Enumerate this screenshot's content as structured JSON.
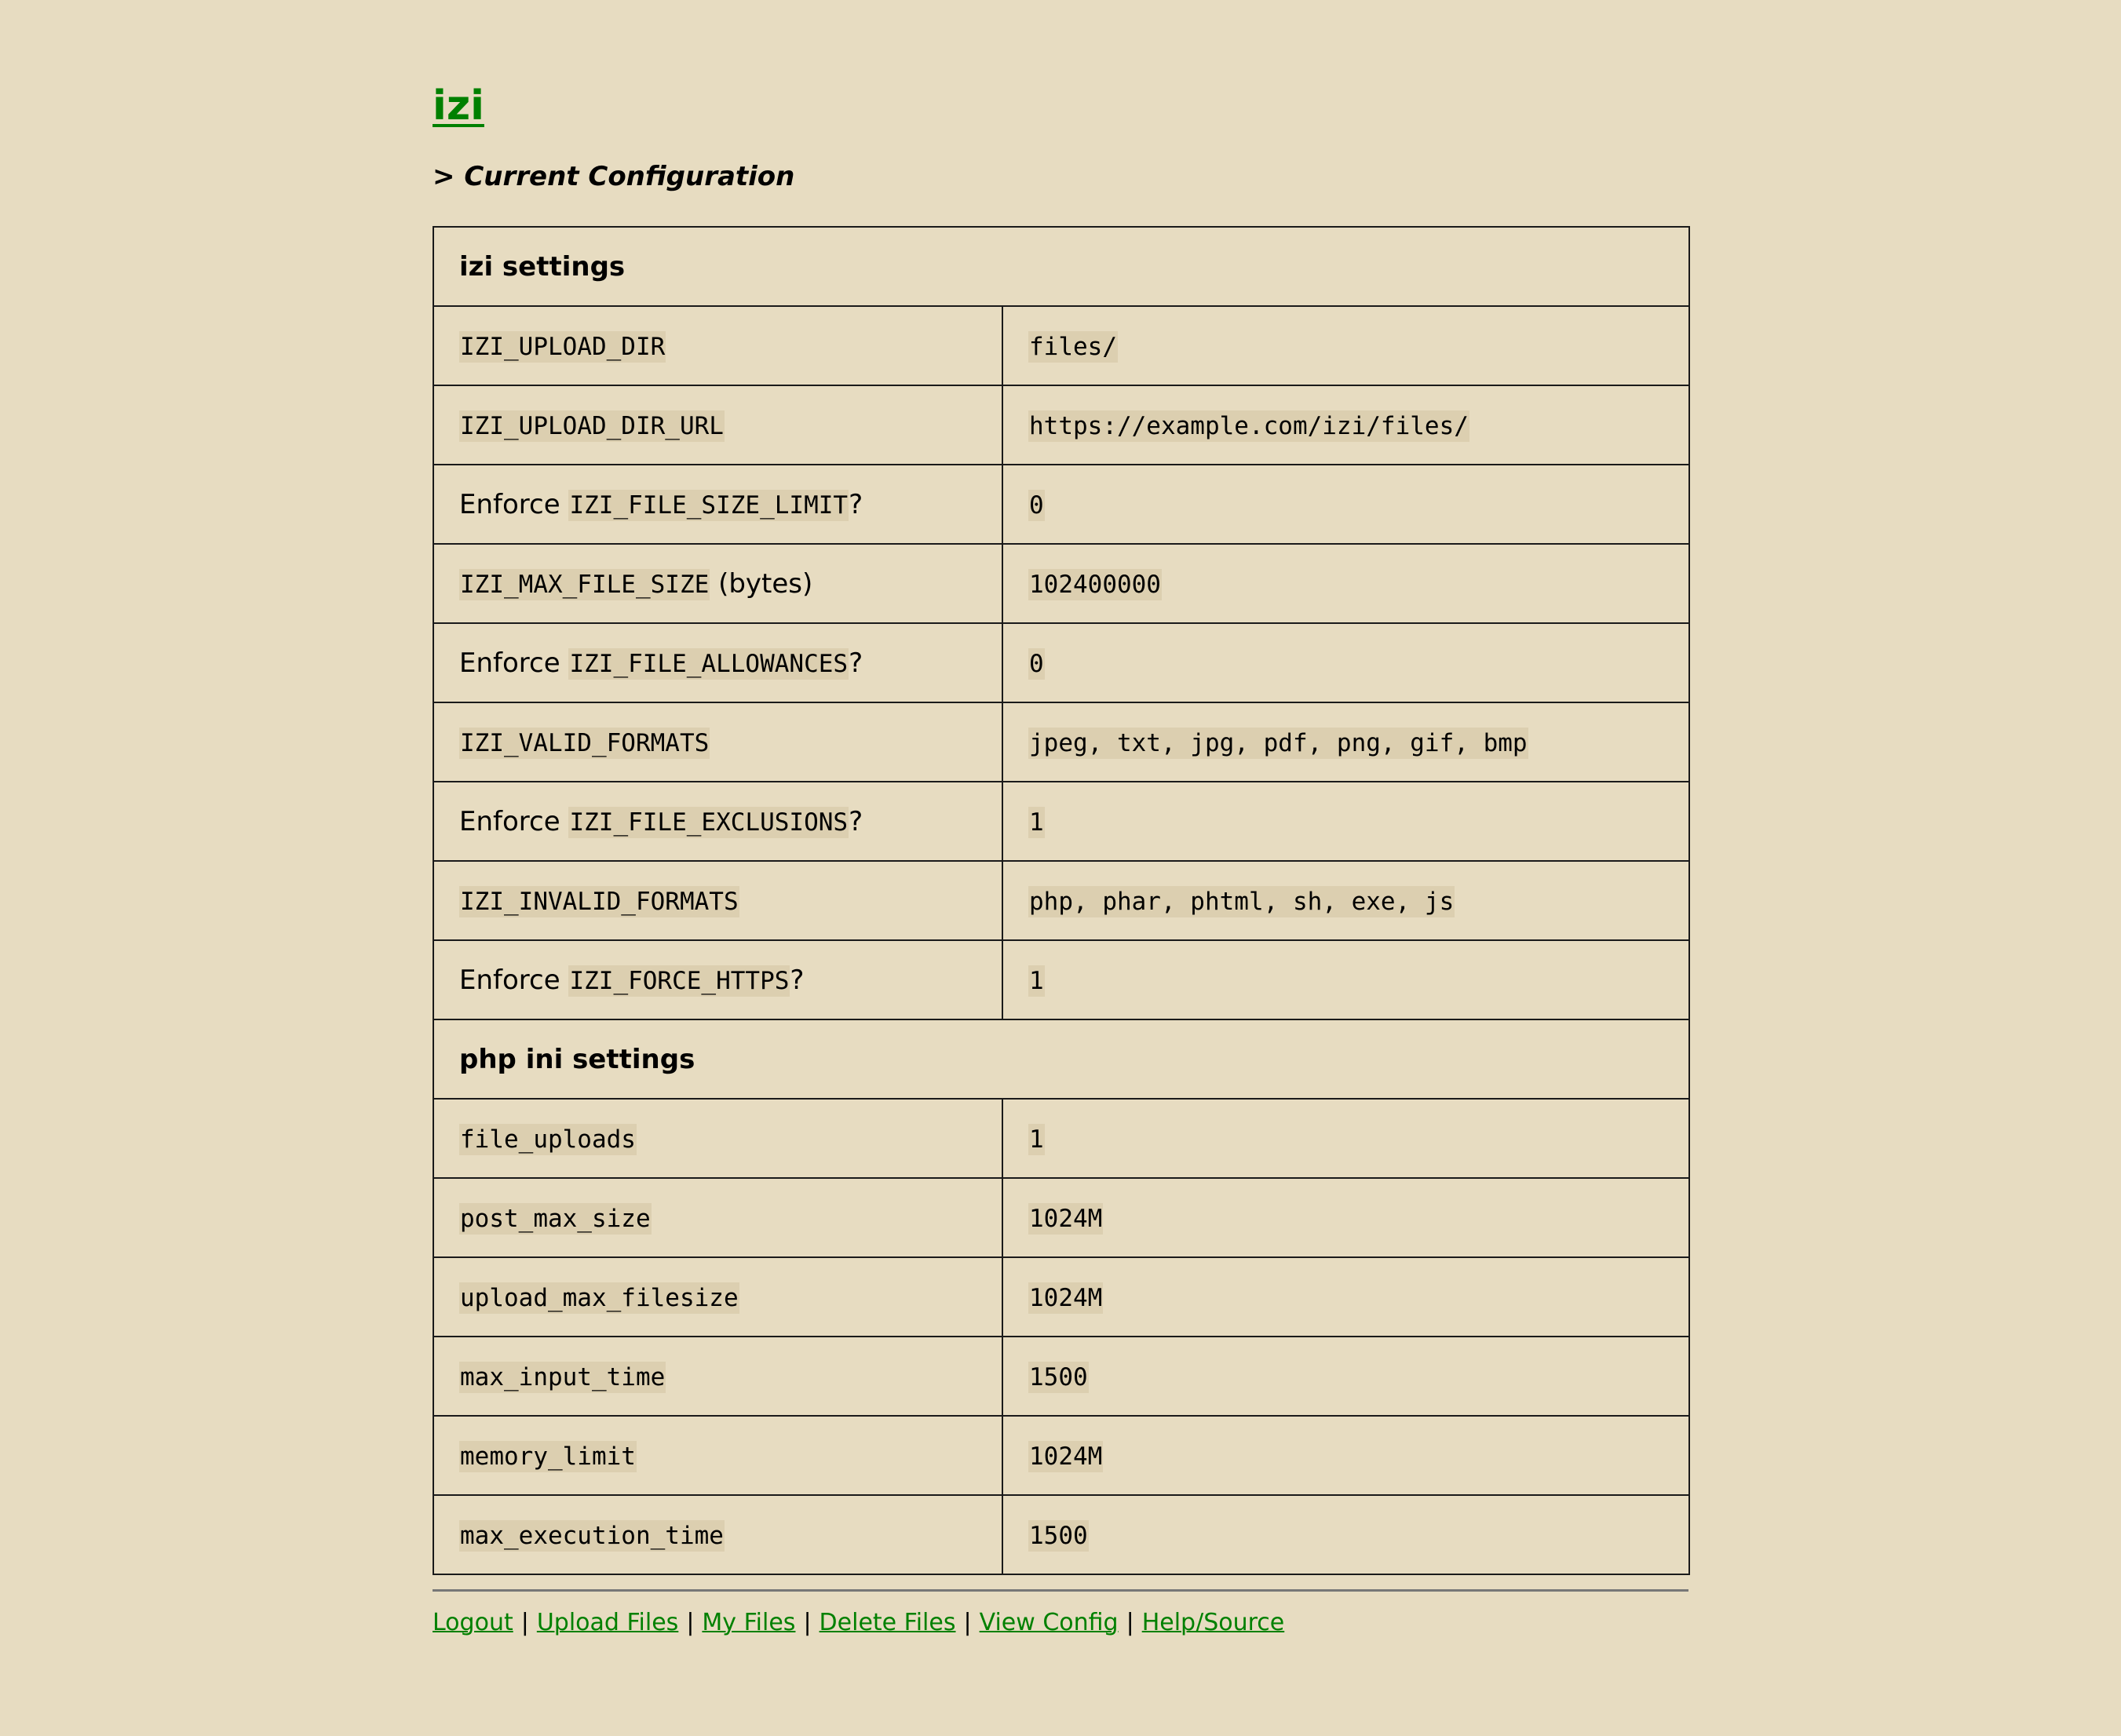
{
  "site": {
    "title": "izi",
    "subtitle": "> Current Configuration"
  },
  "izi_section": {
    "heading": "izi settings",
    "rows": [
      {
        "prefix": "",
        "code": "IZI_UPLOAD_DIR",
        "suffix": "",
        "value": "files/"
      },
      {
        "prefix": "",
        "code": "IZI_UPLOAD_DIR_URL",
        "suffix": "",
        "value": "https://example.com/izi/files/"
      },
      {
        "prefix": "Enforce ",
        "code": "IZI_FILE_SIZE_LIMIT",
        "suffix": "?",
        "value": "0"
      },
      {
        "prefix": "",
        "code": "IZI_MAX_FILE_SIZE",
        "suffix": " (bytes)",
        "value": "102400000"
      },
      {
        "prefix": "Enforce ",
        "code": "IZI_FILE_ALLOWANCES",
        "suffix": "?",
        "value": "0"
      },
      {
        "prefix": "",
        "code": "IZI_VALID_FORMATS",
        "suffix": "",
        "value": "jpeg, txt, jpg, pdf, png, gif, bmp"
      },
      {
        "prefix": "Enforce ",
        "code": "IZI_FILE_EXCLUSIONS",
        "suffix": "?",
        "value": "1"
      },
      {
        "prefix": "",
        "code": "IZI_INVALID_FORMATS",
        "suffix": "",
        "value": "php, phar, phtml, sh, exe, js"
      },
      {
        "prefix": "Enforce ",
        "code": "IZI_FORCE_HTTPS",
        "suffix": "?",
        "value": "1"
      }
    ]
  },
  "php_section": {
    "heading": "php ini settings",
    "rows": [
      {
        "code": "file_uploads",
        "value": "1"
      },
      {
        "code": "post_max_size",
        "value": "1024M"
      },
      {
        "code": "upload_max_filesize",
        "value": "1024M"
      },
      {
        "code": "max_input_time",
        "value": "1500"
      },
      {
        "code": "memory_limit",
        "value": "1024M"
      },
      {
        "code": "max_execution_time",
        "value": "1500"
      }
    ]
  },
  "footer": {
    "links": [
      "Logout",
      "Upload Files",
      "My Files",
      "Delete Files",
      "View Config",
      "Help/Source"
    ],
    "separator": "|"
  },
  "colors": {
    "background": "#e7dcc1",
    "link": "#008000",
    "code_background": "#dccfb0"
  }
}
